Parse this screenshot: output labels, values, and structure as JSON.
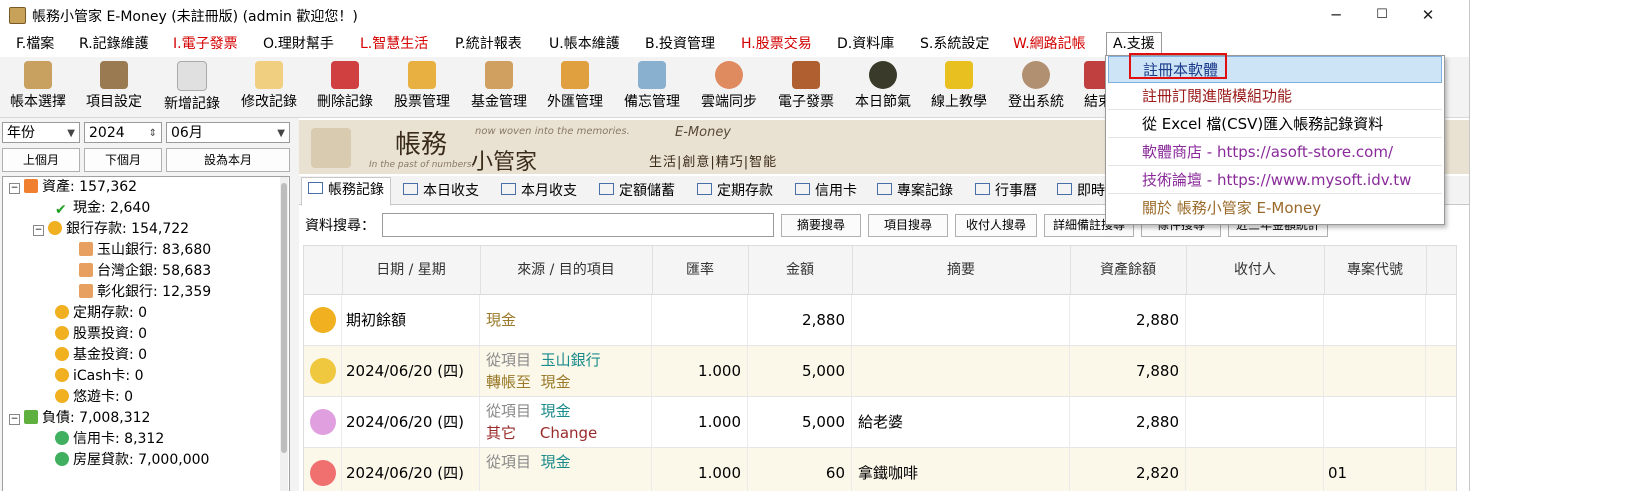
{
  "window": {
    "title": "帳務小管家 E-Money (未註冊版) (admin 歡迎您！)",
    "minimize": "─",
    "maximize": "☐",
    "close": "✕"
  },
  "menu": [
    {
      "label": "F.檔案",
      "color": "normal"
    },
    {
      "label": "R.記錄維護",
      "color": "normal"
    },
    {
      "label": "I.電子發票",
      "color": "red"
    },
    {
      "label": "O.理財幫手",
      "color": "normal"
    },
    {
      "label": "L.智慧生活",
      "color": "red"
    },
    {
      "label": "P.統計報表",
      "color": "normal"
    },
    {
      "label": "U.帳本維護",
      "color": "normal"
    },
    {
      "label": "B.投資管理",
      "color": "normal"
    },
    {
      "label": "H.股票交易",
      "color": "red"
    },
    {
      "label": "D.資料庫",
      "color": "normal"
    },
    {
      "label": "S.系統設定",
      "color": "normal"
    },
    {
      "label": "W.網路記帳",
      "color": "red"
    },
    {
      "label": "A.支援",
      "color": "open"
    }
  ],
  "toolbar": [
    {
      "label": "帳本選擇",
      "icon": "ledger-book-icon",
      "color": "#c8a060"
    },
    {
      "label": "項目設定",
      "icon": "settings-gear-icon",
      "color": "#9a7a50"
    },
    {
      "label": "新增記錄",
      "icon": "add-record-icon",
      "color": "#e0e0e0"
    },
    {
      "label": "修改記錄",
      "icon": "edit-record-icon",
      "color": "#f0d080"
    },
    {
      "label": "刪除記錄",
      "icon": "delete-record-icon",
      "color": "#d04040"
    },
    {
      "label": "股票管理",
      "icon": "stock-chart-icon",
      "color": "#e8b040"
    },
    {
      "label": "基金管理",
      "icon": "fund-bank-icon",
      "color": "#d0a060"
    },
    {
      "label": "外匯管理",
      "icon": "forex-hand-icon",
      "color": "#e0a040"
    },
    {
      "label": "備忘管理",
      "icon": "memo-clipboard-icon",
      "color": "#8ab0d0"
    },
    {
      "label": "雲端同步",
      "icon": "cloud-sync-icon",
      "color": "#e08a60"
    },
    {
      "label": "電子發票",
      "icon": "qr-invoice-icon",
      "color": "#b06030"
    },
    {
      "label": "本日節氣",
      "icon": "solar-term-icon",
      "color": "#3a3a2a"
    },
    {
      "label": "線上教學",
      "icon": "help-question-icon",
      "color": "#e8c020"
    },
    {
      "label": "登出系統",
      "icon": "logout-person-icon",
      "color": "#b09070"
    },
    {
      "label": "結束",
      "icon": "exit-icon",
      "color": "#c04040"
    }
  ],
  "filters": {
    "year_type": "年份",
    "year": "2024",
    "month": "06月",
    "prev_month": "上個月",
    "next_month": "下個月",
    "this_month": "設為本月"
  },
  "tree": [
    {
      "label": "資產: 157,362",
      "level": 0,
      "icon": "asset-a-icon",
      "color": "#f08030",
      "expand": "−"
    },
    {
      "label": "現金: 2,640",
      "level": 1,
      "icon": "checkmark-icon",
      "color": "#20a020"
    },
    {
      "label": "銀行存款: 154,722",
      "level": 1,
      "icon": "coin-icon",
      "color": "#f0b020",
      "expand": "−"
    },
    {
      "label": "玉山銀行: 83,680",
      "level": 2,
      "icon": "bank-card-icon",
      "color": "#e8a060"
    },
    {
      "label": "台灣企銀: 58,683",
      "level": 2,
      "icon": "bank-card-icon",
      "color": "#e8a060"
    },
    {
      "label": "彰化銀行: 12,359",
      "level": 2,
      "icon": "bank-card-icon",
      "color": "#e8a060"
    },
    {
      "label": "定期存款: 0",
      "level": 1,
      "icon": "coin-icon",
      "color": "#f0b020"
    },
    {
      "label": "股票投資: 0",
      "level": 1,
      "icon": "coin-icon",
      "color": "#f0b020"
    },
    {
      "label": "基金投資: 0",
      "level": 1,
      "icon": "coin-icon",
      "color": "#f0b020"
    },
    {
      "label": "iCash卡: 0",
      "level": 1,
      "icon": "coin-icon",
      "color": "#f0b020"
    },
    {
      "label": "悠遊卡: 0",
      "level": 1,
      "icon": "coin-icon",
      "color": "#f0b020"
    },
    {
      "label": "負債: 7,008,312",
      "level": 0,
      "icon": "liability-l-icon",
      "color": "#60b040",
      "expand": "−"
    },
    {
      "label": "信用卡: 8,312",
      "level": 1,
      "icon": "green-coin-icon",
      "color": "#40b060"
    },
    {
      "label": "房屋貸款: 7,000,000",
      "level": 1,
      "icon": "green-coin-icon",
      "color": "#40b060"
    }
  ],
  "banner": {
    "title1": "帳務",
    "title2": "小管家",
    "en1": "now woven into the memories.",
    "en2": "In the past of numbers.",
    "brand": "E-Money",
    "slogan": "生活|創意|精巧|智能"
  },
  "tabs": [
    "帳務記錄",
    "本日收支",
    "本月收支",
    "定額儲蓄",
    "定期存款",
    "信用卡",
    "專案記錄",
    "行事曆",
    "即時"
  ],
  "search": {
    "label": "資料搜尋：",
    "value": "",
    "buttons": [
      "摘要搜尋",
      "項目搜尋",
      "收付人搜尋",
      "詳細備註搜尋",
      "條件搜尋",
      "近三年金額統計"
    ]
  },
  "grid": {
    "headers": [
      "日期 / 星期",
      "來源 / 目的項目",
      "匯率",
      "金額",
      "摘要",
      "資產餘額",
      "收付人",
      "專案代號"
    ],
    "rows": [
      {
        "icon": "money-bag-icon",
        "icon_color": "#f0b020",
        "date": "期初餘額",
        "l1a": "",
        "l1b": "現金",
        "l2a": "",
        "l2b": "",
        "rate": "",
        "amount": "2,880",
        "memo": "",
        "balance": "2,880",
        "payee": "",
        "project": ""
      },
      {
        "icon": "transfer-icon",
        "icon_color": "#f0c840",
        "date": "2024/06/20 (四)",
        "l1a": "從項目",
        "l1b": "玉山銀行",
        "l2a": "轉帳至",
        "l2b": "現金",
        "rate": "1.000",
        "amount": "5,000",
        "memo": "",
        "balance": "7,880",
        "payee": "",
        "project": ""
      },
      {
        "icon": "exchange-icon",
        "icon_color": "#e0a0e0",
        "date": "2024/06/20 (四)",
        "l1a": "從項目",
        "l1b": "現金",
        "l2a": "其它",
        "l2b": "Change",
        "rate": "1.000",
        "amount": "5,000",
        "memo": "給老婆",
        "balance": "2,880",
        "payee": "",
        "project": ""
      },
      {
        "icon": "expense-icon",
        "icon_color": "#f07070",
        "date": "2024/06/20 (四)",
        "l1a": "從項目",
        "l1b": "現金",
        "l2a": "",
        "l2b": "",
        "rate": "1.000",
        "amount": "60",
        "memo": "拿鐵咖啡",
        "balance": "2,820",
        "payee": "",
        "project": "01"
      }
    ]
  },
  "dropdown": [
    "註冊本軟體",
    "註冊訂閱進階模組功能",
    "從 Excel 檔(CSV)匯入帳務記錄資料",
    "軟體商店 - https://asoft-store.com/",
    "技術論壇 - https://www.mysoft.idv.tw",
    "關於 帳務小管家 E-Money"
  ],
  "colors": {
    "red_menu": "#d40000",
    "highlight": "#cde4f7",
    "callout": "#e01010",
    "purple_link": "#8a2a9a"
  }
}
